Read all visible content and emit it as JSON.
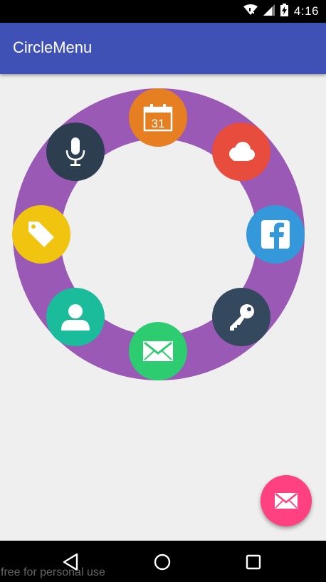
{
  "status_bar": {
    "time": "4:16",
    "icons": [
      "wifi-icon",
      "signal-icon",
      "battery-charging-icon"
    ]
  },
  "app_bar": {
    "title": "CircleMenu"
  },
  "circle_menu": {
    "ring_color": "#9b59b6",
    "items": [
      {
        "icon": "calendar-icon",
        "label": "31",
        "color": "#e67e22"
      },
      {
        "icon": "cloud-icon",
        "color": "#e74c3c"
      },
      {
        "icon": "facebook-icon",
        "label": "f",
        "color": "#3498db"
      },
      {
        "icon": "key-icon",
        "color": "#34495e"
      },
      {
        "icon": "mail-icon",
        "color": "#2ecc71"
      },
      {
        "icon": "user-icon",
        "color": "#1abc9c"
      },
      {
        "icon": "tag-icon",
        "color": "#f1c40f"
      },
      {
        "icon": "microphone-icon",
        "color": "#2c3e50"
      }
    ]
  },
  "fab": {
    "icon": "mail-icon",
    "color": "#ff4081"
  },
  "nav_bar": {
    "buttons": [
      "back-icon",
      "home-icon",
      "recents-icon"
    ]
  },
  "watermark": "free for personal use",
  "colors": {
    "primary": "#3f51b5",
    "background": "#efefef"
  }
}
